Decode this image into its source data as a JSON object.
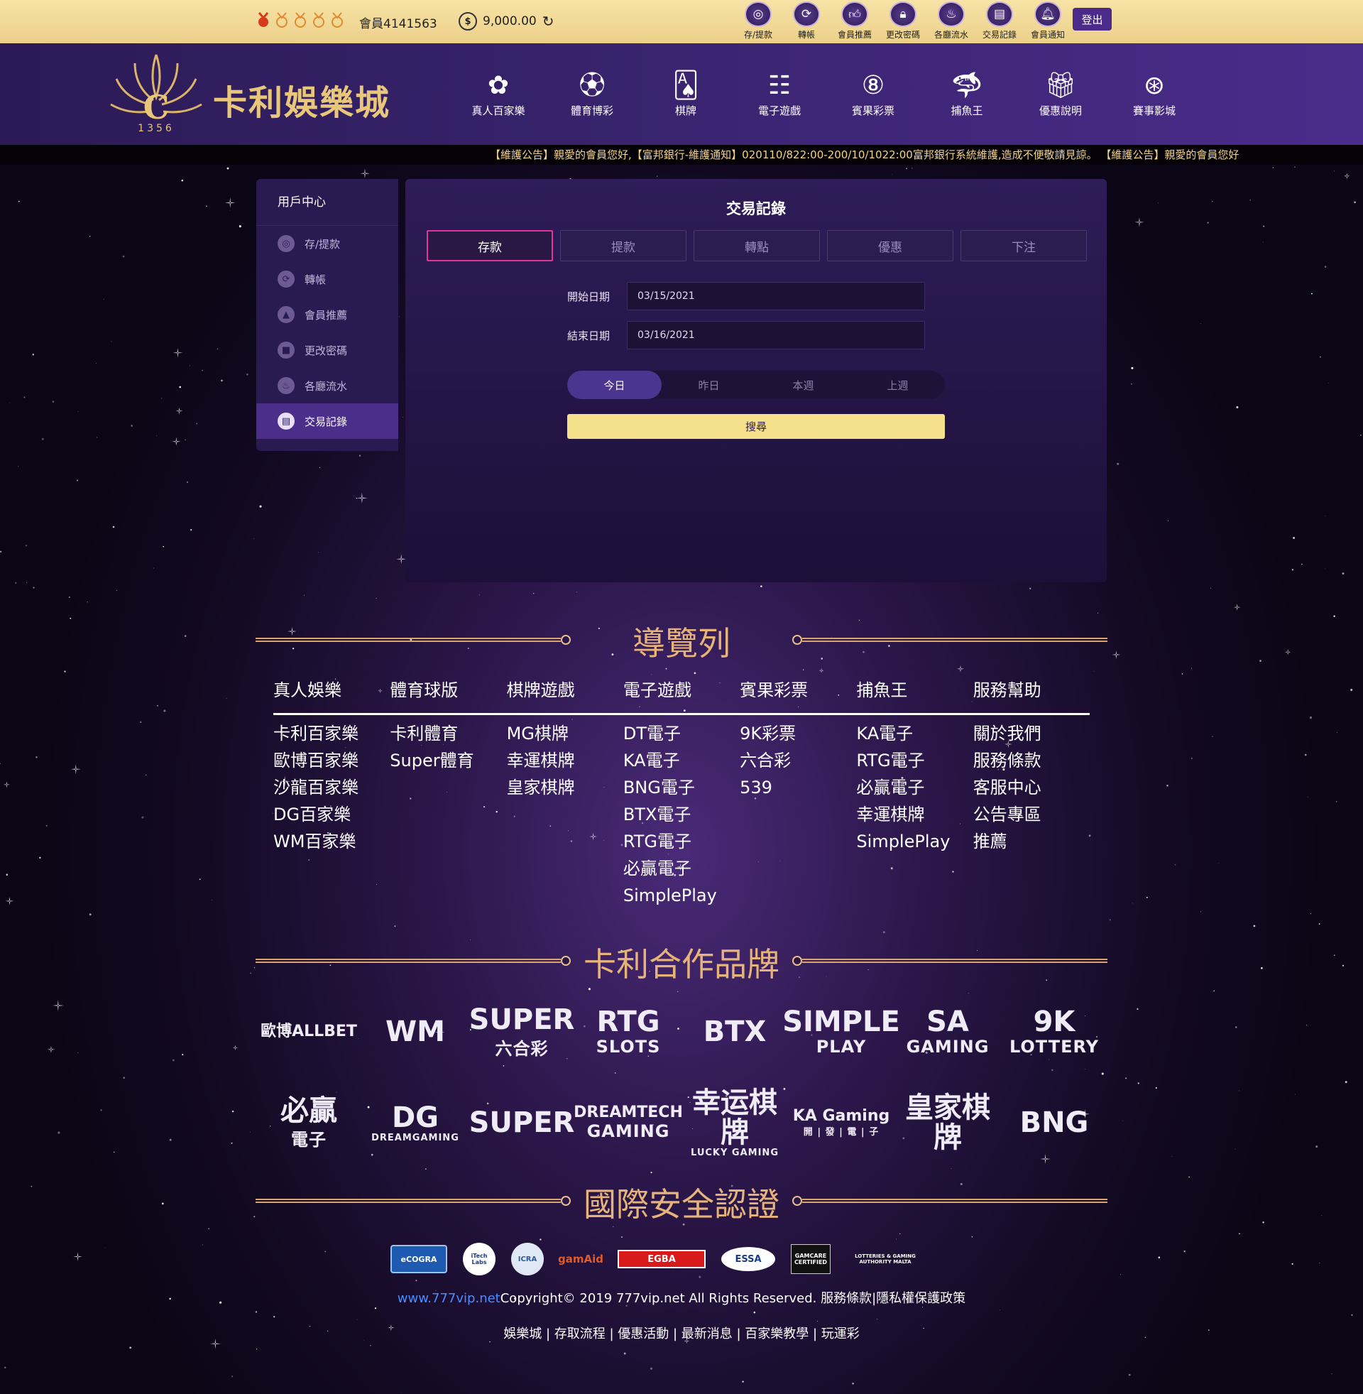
{
  "topbar": {
    "member_id": "會員4141563",
    "balance": "9,000.00",
    "tools": [
      {
        "label": "存/提款",
        "icon": "deposit-icon"
      },
      {
        "label": "轉帳",
        "icon": "transfer-icon"
      },
      {
        "label": "會員推薦",
        "icon": "thumbs-up-icon"
      },
      {
        "label": "更改密碼",
        "icon": "lock-icon"
      },
      {
        "label": "各廳流水",
        "icon": "turnover-icon"
      },
      {
        "label": "交易記錄",
        "icon": "record-icon"
      },
      {
        "label": "會員通知",
        "icon": "bell-icon"
      }
    ],
    "logout": "登出"
  },
  "header": {
    "logo_number": "1356",
    "site_name": "卡利娛樂城",
    "nav": [
      {
        "label": "真人百家樂",
        "icon": "chips-icon"
      },
      {
        "label": "體育博彩",
        "icon": "soccer-ball-icon"
      },
      {
        "label": "棋牌",
        "icon": "cards-icon"
      },
      {
        "label": "電子遊戲",
        "icon": "slot-machine-icon"
      },
      {
        "label": "賓果彩票",
        "icon": "lottery-ball-icon"
      },
      {
        "label": "捕魚王",
        "icon": "shark-icon"
      },
      {
        "label": "優惠說明",
        "icon": "gift-icon"
      },
      {
        "label": "賽事影城",
        "icon": "film-reel-icon"
      }
    ]
  },
  "marquee": "【維護公告】親愛的會員您好,【富邦銀行-維護通知】020110/822:00-200/10/1022:00富邦銀行系統維護,造成不便敬請見諒。 【維護公告】親愛的會員您好",
  "sidebar": {
    "title": "用戶中心",
    "items": [
      {
        "label": "存/提款",
        "icon": "deposit-icon"
      },
      {
        "label": "轉帳",
        "icon": "transfer-icon"
      },
      {
        "label": "會員推薦",
        "icon": "thumbs-up-icon"
      },
      {
        "label": "更改密碼",
        "icon": "lock-icon"
      },
      {
        "label": "各廳流水",
        "icon": "turnover-icon"
      },
      {
        "label": "交易記錄",
        "icon": "record-icon"
      }
    ]
  },
  "panel": {
    "title": "交易記錄",
    "tabs": [
      "存款",
      "提款",
      "轉點",
      "優惠",
      "下注"
    ],
    "start_label": "開始日期",
    "start_value": "03/15/2021",
    "end_label": "結束日期",
    "end_value": "03/16/2021",
    "quick": [
      "今日",
      "昨日",
      "本週",
      "上週"
    ],
    "search": "搜尋"
  },
  "sections": {
    "nav_title": "導覽列",
    "brands_title": "卡利合作品牌",
    "certs_title": "國際安全認證"
  },
  "navlist": [
    {
      "head": "真人娛樂",
      "items": [
        "卡利百家樂",
        "歐博百家樂",
        "沙龍百家樂",
        "DG百家樂",
        "WM百家樂"
      ]
    },
    {
      "head": "體育球版",
      "items": [
        "卡利體育",
        "Super體育"
      ]
    },
    {
      "head": "棋牌遊戲",
      "items": [
        "MG棋牌",
        "幸運棋牌",
        "皇家棋牌"
      ]
    },
    {
      "head": "電子遊戲",
      "items": [
        "DT電子",
        "KA電子",
        "BNG電子",
        "BTX電子",
        "RTG電子",
        "必贏電子",
        "SimplePlay"
      ]
    },
    {
      "head": "賓果彩票",
      "items": [
        "9K彩票",
        "六合彩",
        "539"
      ]
    },
    {
      "head": "捕魚王",
      "items": [
        "KA電子",
        "RTG電子",
        "必贏電子",
        "幸運棋牌",
        "SimplePlay"
      ]
    },
    {
      "head": "服務幫助",
      "items": [
        "關於我們",
        "服務條款",
        "客服中心",
        "公告專區",
        "推薦"
      ]
    }
  ],
  "brands": [
    {
      "main": "歐博ALLBET",
      "sub": ""
    },
    {
      "main": "WM",
      "sub": ""
    },
    {
      "main": "SUPER",
      "sub": "六合彩"
    },
    {
      "main": "RTG",
      "sub": "SLOTS"
    },
    {
      "main": "BTX",
      "sub": ""
    },
    {
      "main": "SIMPLE",
      "sub": "PLAY"
    },
    {
      "main": "SA",
      "sub": "GAMING"
    },
    {
      "main": "9K",
      "sub": "LOTTERY"
    },
    {
      "main": "必贏",
      "sub": "電子"
    },
    {
      "main": "DG",
      "sub": "DREAMGAMING"
    },
    {
      "main": "SUPER",
      "sub": ""
    },
    {
      "main": "DREAMTECH",
      "sub": "GAMING"
    },
    {
      "main": "幸运棋牌",
      "sub": "LUCKY GAMING"
    },
    {
      "main": "KA Gaming",
      "sub": "開 | 發 | 電 | 子"
    },
    {
      "main": "皇家棋牌",
      "sub": ""
    },
    {
      "main": "BNG",
      "sub": ""
    }
  ],
  "certs": [
    "eCOGRA",
    "iTech Labs",
    "ICRA",
    "gamAid",
    "EGBA",
    "ESSA",
    "GAMCARE CERTIFIED",
    "LOTTERIES & GAMING AUTHORITY MALTA"
  ],
  "footer": {
    "link": "www.777vip.net",
    "copyright": "Copyright© 2019 777vip.net All Rights Reserved. 服務條款|隱私權保護政策",
    "links": "娛樂城 | 存取流程 | 優惠活動 | 最新消息 | 百家樂教學 | 玩運彩"
  },
  "colors": {
    "gold": "#e6b47a",
    "topbar": "#f2dc9a",
    "purple": "#3a2470",
    "accent": "#e0359a"
  }
}
